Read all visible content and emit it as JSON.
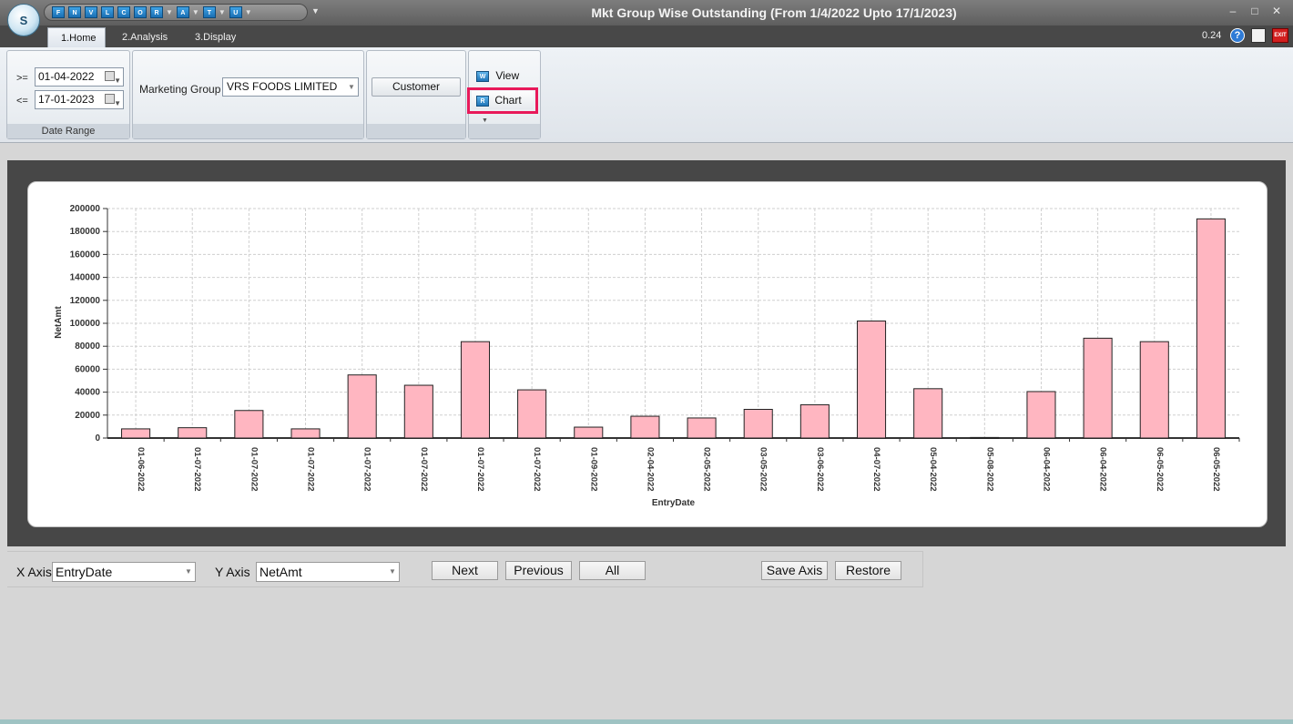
{
  "window": {
    "title": "Mkt Group Wise Outstanding (From 1/4/2022 Upto 17/1/2023)",
    "logo_text": "S"
  },
  "quick_access": [
    {
      "icon": "F",
      "dropdown": false
    },
    {
      "icon": "N",
      "dropdown": false
    },
    {
      "icon": "V",
      "dropdown": false
    },
    {
      "icon": "L",
      "dropdown": false
    },
    {
      "icon": "C",
      "dropdown": false
    },
    {
      "icon": "O",
      "dropdown": false
    },
    {
      "icon": "R",
      "dropdown": true
    },
    {
      "icon": "A",
      "dropdown": true
    },
    {
      "icon": "T",
      "dropdown": true
    },
    {
      "icon": "U",
      "dropdown": true
    }
  ],
  "tabs": [
    {
      "label": "1.Home",
      "active": true
    },
    {
      "label": "2.Analysis",
      "active": false
    },
    {
      "label": "3.Display",
      "active": false
    }
  ],
  "toolbar_right": {
    "zoom": "0.24",
    "exit_label": "EXIT"
  },
  "ribbon": {
    "date_range": {
      "from_op": ">=",
      "from_value": "01-04-2022",
      "to_op": "<=",
      "to_value": "17-01-2023",
      "group_label": "Date Range"
    },
    "marketing": {
      "label": "Marketing Group",
      "value": "VRS FOODS LIMITED"
    },
    "customer_button": "Customer",
    "view_button": "View",
    "chart_button": "Chart",
    "highlight_color": "#e8195a"
  },
  "chart_data": {
    "type": "bar",
    "xlabel": "EntryDate",
    "ylabel": "NetAmt",
    "ylim": [
      0,
      200000
    ],
    "yticks": [
      "0",
      "20000",
      "40000",
      "60000",
      "80000",
      "100000",
      "120000",
      "140000",
      "160000",
      "180000",
      "200000"
    ],
    "categories": [
      "01-06-2022",
      "01-07-2022",
      "01-07-2022",
      "01-07-2022",
      "01-07-2022",
      "01-07-2022",
      "01-07-2022",
      "01-07-2022",
      "01-09-2022",
      "02-04-2022",
      "02-05-2022",
      "03-05-2022",
      "03-06-2022",
      "04-07-2022",
      "05-04-2022",
      "05-08-2022",
      "06-04-2022",
      "06-04-2022",
      "06-05-2022",
      "06-05-2022"
    ],
    "values": [
      8000,
      9000,
      24000,
      8000,
      55000,
      46000,
      84000,
      42000,
      9500,
      19000,
      17500,
      25000,
      29000,
      102000,
      43000,
      500,
      40500,
      87000,
      84000,
      191000
    ],
    "bar_color": "#ffb6c1",
    "grid": true
  },
  "controls": {
    "x_axis_label": "X Axis",
    "x_axis_value": "EntryDate",
    "y_axis_label": "Y Axis",
    "y_axis_value": "NetAmt",
    "next": "Next",
    "previous": "Previous",
    "all": "All",
    "save_axis": "Save Axis",
    "restore": "Restore"
  }
}
